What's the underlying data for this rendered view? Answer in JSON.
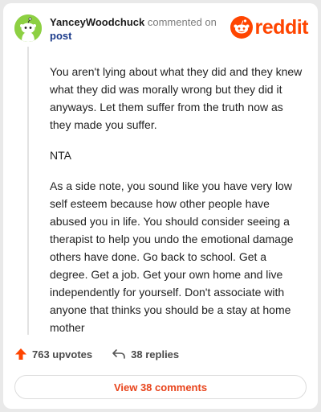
{
  "comment": {
    "username": "YanceyWoodchuck",
    "action_text": "commented on",
    "target": "post",
    "paragraphs": [
      "You aren't lying about what they did and they knew what they did was morally wrong but they did it anyways. Let them suffer from the truth now as they made you suffer.",
      "NTA",
      "As a side note, you sound like you have very low self esteem because how other people have abused you in life. You should consider seeing a therapist to help you undo the emotional damage others have done. Go back to school. Get a degree. Get a job. Get your own home and live independently for yourself. Don't associate with anyone that thinks you should be a stay at home mother"
    ]
  },
  "brand": {
    "name": "reddit",
    "color": "#ff4500"
  },
  "actions": {
    "upvotes": "763 upvotes",
    "replies": "38 replies"
  },
  "view_button": {
    "label": "View 38 comments"
  },
  "icons": {
    "avatar": "snoo-avatar-icon",
    "logo": "reddit-logo-icon",
    "upvote": "upvote-arrow-icon",
    "reply": "reply-arrow-icon"
  }
}
